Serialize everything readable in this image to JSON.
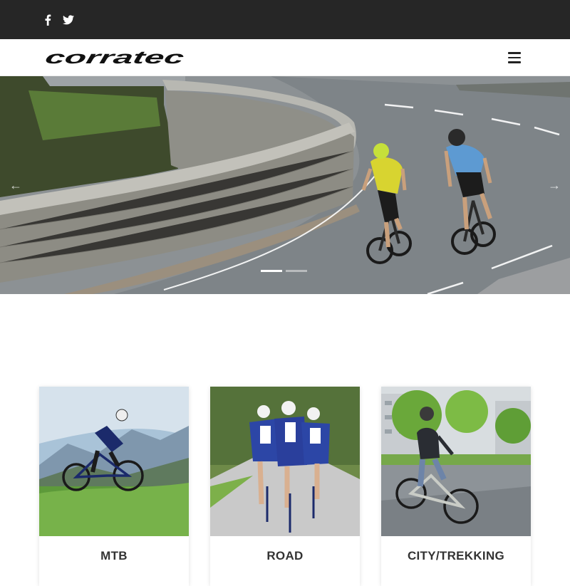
{
  "social": [
    {
      "name": "facebook-icon",
      "glyph": "f"
    },
    {
      "name": "twitter-icon",
      "glyph": "t"
    }
  ],
  "header": {
    "logo_text": "corratec",
    "menu_icon": "hamburger-menu-icon"
  },
  "slider": {
    "prev_icon": "chevron-left-icon",
    "next_icon": "chevron-right-icon",
    "prev_glyph": "←",
    "next_glyph": "→",
    "slide_count": 2,
    "active_slide": 1
  },
  "categories": [
    {
      "label": "MTB"
    },
    {
      "label": "ROAD"
    },
    {
      "label": "CITY/TREKKING"
    }
  ],
  "colors": {
    "topbar": "#262626",
    "text": "#333333"
  }
}
